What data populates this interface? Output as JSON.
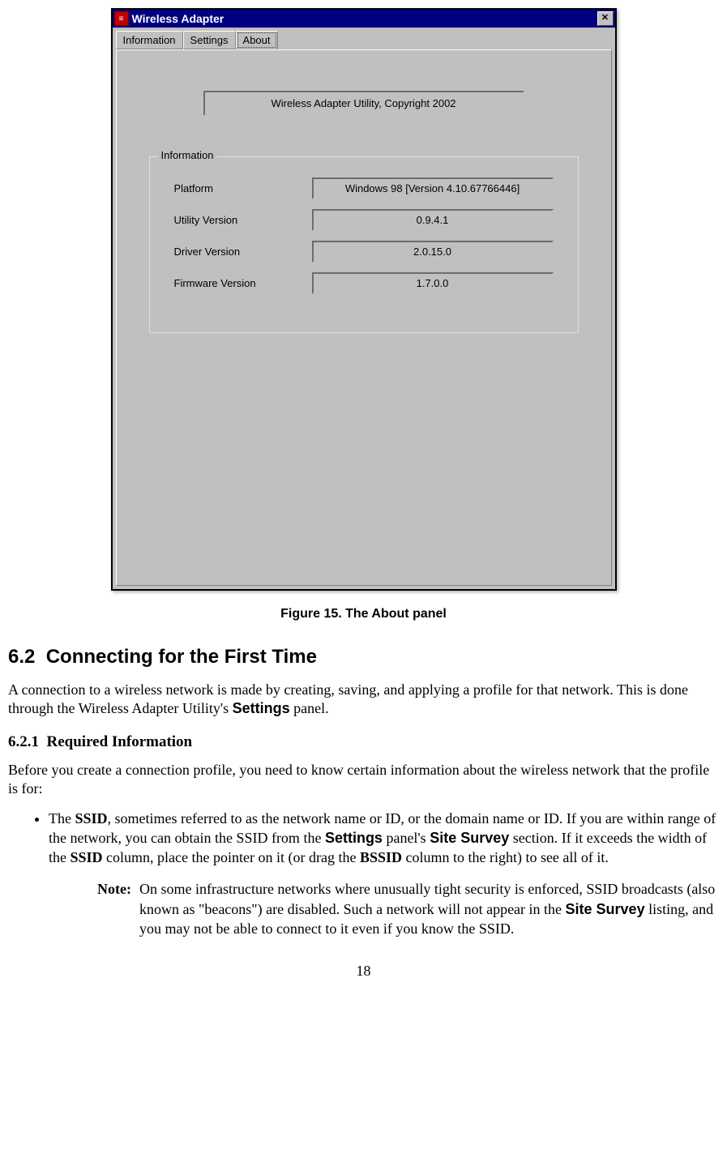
{
  "window": {
    "title": "Wireless Adapter",
    "tabs": [
      "Information",
      "Settings",
      "About"
    ],
    "active_tab": "About",
    "copyright": "Wireless Adapter Utility, Copyright 2002",
    "groupbox_title": "Information",
    "info_rows": [
      {
        "label": "Platform",
        "value": "Windows 98 [Version 4.10.67766446]"
      },
      {
        "label": "Utility Version",
        "value": "0.9.4.1"
      },
      {
        "label": "Driver Version",
        "value": "2.0.15.0"
      },
      {
        "label": "Firmware Version",
        "value": "1.7.0.0"
      }
    ],
    "close": "✕"
  },
  "figure_caption": "Figure 15.  The About panel",
  "section": {
    "number": "6.2",
    "title": "Connecting for the First Time"
  },
  "para1_pre": "A connection to a wireless network is made by creating, saving, and applying a profile for that network. This is done through the Wireless Adapter Utility's ",
  "para1_bold": "Settings",
  "para1_post": " panel.",
  "subsection": {
    "number": "6.2.1",
    "title": "Required Information"
  },
  "para2": "Before you create a connection profile, you need to know certain information about the wireless network that the profile is for:",
  "bullet": {
    "t1": "The ",
    "b1": "SSID",
    "t2": ", sometimes referred to as the network name or ID, or the domain name or ID. If you are within range of the network, you can obtain the SSID from the ",
    "b2": "Settings",
    "t3": " panel's ",
    "b3": "Site Survey",
    "t4": " section. If it exceeds the width of the ",
    "b4": "SSID",
    "t5": " column, place the pointer on it (or drag the ",
    "b5": "BSSID",
    "t6": " column to the right) to see all of it."
  },
  "note": {
    "label": "Note:",
    "t1": "On some infrastructure networks where unusually tight security is enforced, SSID broadcasts (also known as \"beacons\") are disabled. Such a network will not appear in the ",
    "b1": "Site Survey",
    "t2": " listing, and you may not be able to connect to it even if you know the SSID."
  },
  "page_number": "18"
}
